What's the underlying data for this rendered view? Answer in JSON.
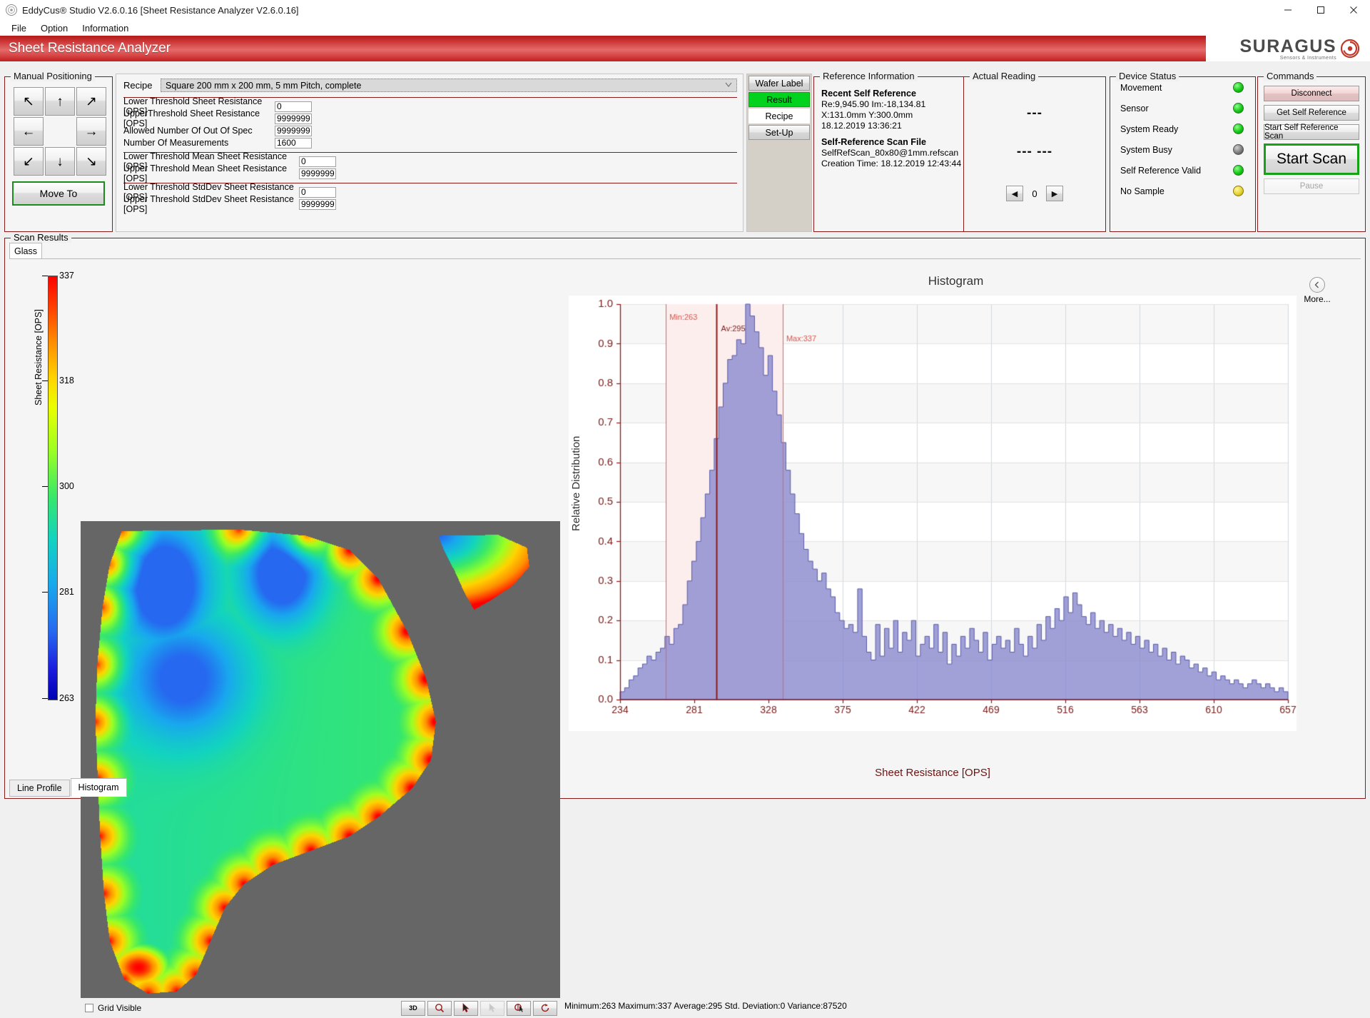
{
  "window": {
    "title": "EddyCus® Studio V2.6.0.16 [Sheet Resistance Analyzer V2.6.0.16]",
    "minimize": "—",
    "maximize": "▢",
    "close": "✕"
  },
  "menu": {
    "items": [
      "File",
      "Option",
      "Information"
    ]
  },
  "header": {
    "app_title": "Sheet Resistance Analyzer",
    "brand_name": "SURAGUS",
    "brand_sub": "Sensors & Instruments"
  },
  "manual_positioning": {
    "legend": "Manual Positioning",
    "buttons": [
      "↖",
      "↑",
      "↗",
      "←",
      "",
      "→",
      "↙",
      "↓",
      "↘"
    ],
    "move_to": "Move To"
  },
  "recipe": {
    "label": "Recipe",
    "value": "Square 200 mm x 200 mm, 5 mm Pitch, complete",
    "group_a": [
      {
        "label": "Lower Threshold Sheet Resistance [OPS]",
        "value": "0"
      },
      {
        "label": "UpperThreshold Sheet Resistance [OPS]",
        "value": "9999999"
      },
      {
        "label": "Allowed Number Of Out Of Spec",
        "value": "9999999"
      },
      {
        "label": "Number Of Measurements",
        "value": "1600"
      }
    ],
    "group_b": [
      {
        "label": "Lower Threshold Mean Sheet Resistance [OPS]",
        "value": "0"
      },
      {
        "label": "Upper Threshold Mean Sheet Resistance [OPS]",
        "value": "9999999"
      }
    ],
    "group_c": [
      {
        "label": "Lower Threshold StdDev Sheet Resistance [OPS]",
        "value": "0"
      },
      {
        "label": "Upper Threshold StdDev Sheet Resistance [OPS]",
        "value": "9999999"
      }
    ]
  },
  "mode_tabs": [
    {
      "label": "Wafer Label",
      "state": "normal"
    },
    {
      "label": "Result",
      "state": "selected"
    },
    {
      "label": "Recipe",
      "state": "white"
    },
    {
      "label": "Set-Up",
      "state": "normal"
    }
  ],
  "reference_information": {
    "legend": "Reference Information",
    "recent_title": "Recent Self Reference",
    "recent_lines": [
      "Re:9,945.90 Im:-18,134.81",
      "X:131.0mm Y:300.0mm",
      "18.12.2019 13:36:21"
    ],
    "file_title": "Self-Reference Scan File",
    "file_lines": [
      "SelfRefScan_80x80@1mm.refscan",
      "Creation Time: 18.12.2019 12:43:44"
    ]
  },
  "actual_reading": {
    "legend": "Actual Reading",
    "main": "---",
    "sub": "---  ---",
    "prev": "◀",
    "next": "▶",
    "index": "0"
  },
  "device_status": {
    "legend": "Device Status",
    "rows": [
      {
        "label": "Movement",
        "led": "green"
      },
      {
        "label": "Sensor",
        "led": "green"
      },
      {
        "label": "System Ready",
        "led": "green"
      },
      {
        "label": "System Busy",
        "led": "grey"
      },
      {
        "label": "Self Reference Valid",
        "led": "green"
      },
      {
        "label": "No Sample",
        "led": "amber"
      }
    ]
  },
  "commands": {
    "legend": "Commands",
    "disconnect": "Disconnect",
    "get_self_reference": "Get Self Reference",
    "start_self_reference_scan": "Start Self Reference Scan",
    "start_scan": "Start Scan",
    "pause": "Pause"
  },
  "scan_results": {
    "legend": "Scan Results",
    "sample_tab": "Glass",
    "colorbar": {
      "axis_title": "Sheet Resistance [OPS]",
      "ticks": [
        "337",
        "318",
        "300",
        "281",
        "263"
      ]
    },
    "grid_visible": "Grid Visible",
    "tools": [
      "3D",
      "zoom-icon",
      "pointer-icon",
      "pointer-disabled-icon",
      "cursor-icon",
      "reset-icon"
    ],
    "statistics": "Minimum:263  Maximum:337  Average:295  Std. Deviation:0 Variance:87520",
    "bottom_tabs": [
      {
        "label": "Line Profile",
        "active": false
      },
      {
        "label": "Histogram",
        "active": true
      }
    ],
    "more": "More..."
  },
  "chart_data": {
    "type": "bar",
    "title": "Histogram",
    "xlabel": "Sheet Resistance [OPS]",
    "ylabel": "Relative Distribution",
    "xlim": [
      234,
      657
    ],
    "ylim": [
      0.0,
      1.0
    ],
    "xticks": [
      234,
      281,
      328,
      375,
      422,
      469,
      516,
      563,
      610,
      657
    ],
    "yticks": [
      "0.0",
      "0.1",
      "0.2",
      "0.3",
      "0.4",
      "0.5",
      "0.6",
      "0.7",
      "0.8",
      "0.9",
      "1.0"
    ],
    "grid": true,
    "bar_fill": "#8c8cd0",
    "bar_stroke": "#5a5aa8",
    "marker_color": "#e06060",
    "band_color": "#fdeeee",
    "annotations": [
      {
        "label": "Min:263",
        "x": 263
      },
      {
        "label": "Av:295",
        "x": 295
      },
      {
        "label": "Max:337",
        "x": 337
      }
    ],
    "bin_width": 3,
    "values": [
      0.02,
      0.03,
      0.05,
      0.06,
      0.08,
      0.09,
      0.11,
      0.1,
      0.12,
      0.13,
      0.16,
      0.14,
      0.18,
      0.19,
      0.24,
      0.3,
      0.35,
      0.4,
      0.46,
      0.52,
      0.58,
      0.66,
      0.74,
      0.8,
      0.86,
      0.87,
      0.91,
      0.9,
      1.0,
      0.97,
      0.93,
      0.89,
      0.82,
      0.87,
      0.78,
      0.72,
      0.65,
      0.58,
      0.52,
      0.47,
      0.42,
      0.38,
      0.35,
      0.33,
      0.3,
      0.32,
      0.28,
      0.26,
      0.22,
      0.2,
      0.18,
      0.19,
      0.17,
      0.28,
      0.16,
      0.12,
      0.1,
      0.19,
      0.11,
      0.18,
      0.13,
      0.2,
      0.12,
      0.17,
      0.15,
      0.2,
      0.11,
      0.14,
      0.16,
      0.13,
      0.19,
      0.12,
      0.17,
      0.09,
      0.14,
      0.11,
      0.16,
      0.13,
      0.18,
      0.15,
      0.12,
      0.17,
      0.1,
      0.14,
      0.16,
      0.13,
      0.15,
      0.12,
      0.18,
      0.14,
      0.11,
      0.16,
      0.13,
      0.19,
      0.15,
      0.21,
      0.18,
      0.23,
      0.2,
      0.26,
      0.22,
      0.27,
      0.24,
      0.21,
      0.19,
      0.22,
      0.18,
      0.2,
      0.17,
      0.19,
      0.16,
      0.18,
      0.15,
      0.17,
      0.14,
      0.16,
      0.13,
      0.15,
      0.12,
      0.14,
      0.11,
      0.13,
      0.1,
      0.12,
      0.09,
      0.11,
      0.1,
      0.08,
      0.09,
      0.07,
      0.08,
      0.06,
      0.07,
      0.05,
      0.06,
      0.05,
      0.04,
      0.05,
      0.04,
      0.03,
      0.04,
      0.05,
      0.04,
      0.03,
      0.04,
      0.03,
      0.02,
      0.03,
      0.02
    ]
  }
}
